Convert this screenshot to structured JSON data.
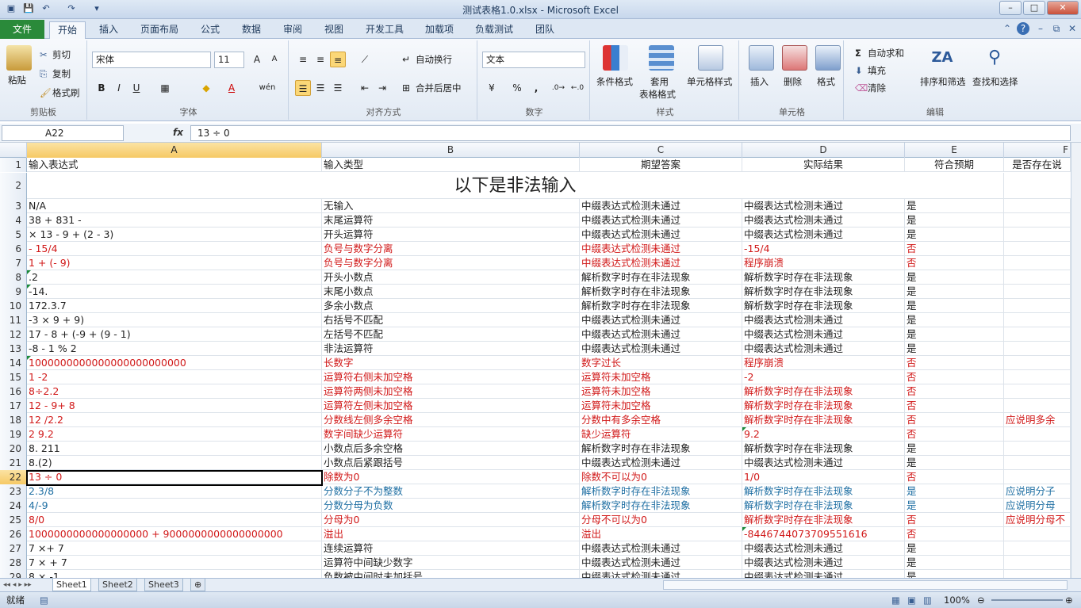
{
  "window": {
    "title": "测试表格1.0.xlsx  -  Microsoft Excel"
  },
  "tabs": [
    "文件",
    "开始",
    "插入",
    "页面布局",
    "公式",
    "数据",
    "审阅",
    "视图",
    "开发工具",
    "加载项",
    "负载测试",
    "团队"
  ],
  "ribbon": {
    "clipboard": {
      "label": "剪贴板",
      "paste": "粘贴",
      "cut": "剪切",
      "copy": "复制",
      "painter": "格式刷"
    },
    "font": {
      "label": "字体",
      "name": "宋体",
      "size": "11",
      "bold": "B",
      "italic": "I",
      "underline": "U",
      "phonetic": "wén"
    },
    "alignment": {
      "label": "对齐方式",
      "wrap": "自动换行",
      "merge": "合并后居中"
    },
    "number": {
      "label": "数字",
      "format": "文本",
      "percent": "%",
      "comma": ","
    },
    "styles": {
      "label": "样式",
      "conditional": "条件格式",
      "table_line1": "套用",
      "table_line2": "表格格式",
      "cell_styles": "单元格样式"
    },
    "cells": {
      "label": "单元格",
      "insert": "插入",
      "delete": "删除",
      "format": "格式"
    },
    "editing": {
      "label": "编辑",
      "autosum": "自动求和",
      "fill": "填充",
      "clear": "清除",
      "sort": "排序和筛选",
      "find": "查找和选择"
    }
  },
  "formula_bar": {
    "name_box": "A22",
    "fx": "fx",
    "formula": "13 ÷ 0"
  },
  "columns": [
    "A",
    "B",
    "C",
    "D",
    "E",
    "F"
  ],
  "sheet": {
    "header": [
      "输入表达式",
      "输入类型",
      "期望答案",
      "实际结果",
      "符合预期",
      "是否存在说"
    ],
    "banner": "以下是非法输入",
    "rows": [
      {
        "n": "3",
        "c": "",
        "a": "N/A",
        "b": "无输入",
        "cc": "中缀表达式检测未通过",
        "d": "中缀表达式检测未通过",
        "e": "是",
        "f": ""
      },
      {
        "n": "4",
        "c": "",
        "a": "38 + 831 -",
        "b": "末尾运算符",
        "cc": "中缀表达式检测未通过",
        "d": "中缀表达式检测未通过",
        "e": "是",
        "f": ""
      },
      {
        "n": "5",
        "c": "",
        "a": "× 13 - 9 + (2 - 3)",
        "b": "开头运算符",
        "cc": "中缀表达式检测未通过",
        "d": "中缀表达式检测未通过",
        "e": "是",
        "f": ""
      },
      {
        "n": "6",
        "c": "red",
        "a": "- 15/4",
        "b": "负号与数字分离",
        "cc": "中缀表达式检测未通过",
        "d": "-15/4",
        "e": "否",
        "f": ""
      },
      {
        "n": "7",
        "c": "red",
        "a": "1 + (- 9)",
        "b": "负号与数字分离",
        "cc": "中缀表达式检测未通过",
        "d": "程序崩溃",
        "e": "否",
        "f": ""
      },
      {
        "n": "8",
        "c": "",
        "a": ".2",
        "b": "开头小数点",
        "cc": "解析数字时存在非法现象",
        "d": "解析数字时存在非法现象",
        "e": "是",
        "f": "",
        "tri": "a"
      },
      {
        "n": "9",
        "c": "",
        "a": "-14.",
        "b": "末尾小数点",
        "cc": "解析数字时存在非法现象",
        "d": "解析数字时存在非法现象",
        "e": "是",
        "f": "",
        "tri": "a"
      },
      {
        "n": "10",
        "c": "",
        "a": "172.3.7",
        "b": "多余小数点",
        "cc": "解析数字时存在非法现象",
        "d": "解析数字时存在非法现象",
        "e": "是",
        "f": ""
      },
      {
        "n": "11",
        "c": "",
        "a": "-3 × 9 + 9)",
        "b": "右括号不匹配",
        "cc": "中缀表达式检测未通过",
        "d": "中缀表达式检测未通过",
        "e": "是",
        "f": ""
      },
      {
        "n": "12",
        "c": "",
        "a": "17 - 8 + (-9 + (9 - 1)",
        "b": "左括号不匹配",
        "cc": "中缀表达式检测未通过",
        "d": "中缀表达式检测未通过",
        "e": "是",
        "f": ""
      },
      {
        "n": "13",
        "c": "",
        "a": "-8 - 1 % 2",
        "b": "非法运算符",
        "cc": "中缀表达式检测未通过",
        "d": "中缀表达式检测未通过",
        "e": "是",
        "f": ""
      },
      {
        "n": "14",
        "c": "red",
        "a": "1000000000000000000000000",
        "b": "长数字",
        "cc": "数字过长",
        "d": "程序崩溃",
        "e": "否",
        "f": "",
        "tri": "a"
      },
      {
        "n": "15",
        "c": "red",
        "a": "1 -2",
        "b": "运算符右侧未加空格",
        "cc": "运算符未加空格",
        "d": "-2",
        "e": "否",
        "f": ""
      },
      {
        "n": "16",
        "c": "red",
        "a": "8÷2.2",
        "b": "运算符两侧未加空格",
        "cc": "运算符未加空格",
        "d": "解析数字时存在非法现象",
        "e": "否",
        "f": ""
      },
      {
        "n": "17",
        "c": "red",
        "a": "12 - 9+ 8",
        "b": "运算符左侧未加空格",
        "cc": "运算符未加空格",
        "d": "解析数字时存在非法现象",
        "e": "否",
        "f": ""
      },
      {
        "n": "18",
        "c": "red",
        "a": "12 /2.2",
        "b": "分数线左侧多余空格",
        "cc": "分数中有多余空格",
        "d": "解析数字时存在非法现象",
        "e": "否",
        "f": "应说明多余"
      },
      {
        "n": "19",
        "c": "red",
        "a": "2 9.2",
        "b": "数字间缺少运算符",
        "cc": "缺少运算符",
        "d": "9.2",
        "e": "否",
        "f": "",
        "tri": "d"
      },
      {
        "n": "20",
        "c": "",
        "a": "8. 211",
        "b": "小数点后多余空格",
        "cc": "解析数字时存在非法现象",
        "d": "解析数字时存在非法现象",
        "e": "是",
        "f": ""
      },
      {
        "n": "21",
        "c": "",
        "a": "8.(2)",
        "b": "小数点后紧跟括号",
        "cc": "中缀表达式检测未通过",
        "d": "中缀表达式检测未通过",
        "e": "是",
        "f": ""
      },
      {
        "n": "22",
        "c": "red",
        "a": "13 ÷ 0",
        "b": "除数为0",
        "cc": "除数不可以为0",
        "d": "1/0",
        "e": "否",
        "f": "",
        "sel": true
      },
      {
        "n": "23",
        "c": "blue",
        "a": "2.3/8",
        "b": "分数分子不为整数",
        "cc": "解析数字时存在非法现象",
        "d": "解析数字时存在非法现象",
        "e": "是",
        "f": "应说明分子"
      },
      {
        "n": "24",
        "c": "blue",
        "a": "4/-9",
        "b": "分数分母为负数",
        "cc": "解析数字时存在非法现象",
        "d": "解析数字时存在非法现象",
        "e": "是",
        "f": "应说明分母"
      },
      {
        "n": "25",
        "c": "red",
        "a": "8/0",
        "b": "分母为0",
        "cc": "分母不可以为0",
        "d": "解析数字时存在非法现象",
        "e": "否",
        "f": "应说明分母不"
      },
      {
        "n": "26",
        "c": "red",
        "a": "1000000000000000000 + 9000000000000000000",
        "b": "溢出",
        "cc": "溢出",
        "d": "-8446744073709551616",
        "e": "否",
        "f": "",
        "tri": "d"
      },
      {
        "n": "27",
        "c": "",
        "a": "7 ×+ 7",
        "b": "连续运算符",
        "cc": "中缀表达式检测未通过",
        "d": "中缀表达式检测未通过",
        "e": "是",
        "f": ""
      },
      {
        "n": "28",
        "c": "",
        "a": "7 × + 7",
        "b": "运算符中间缺少数字",
        "cc": "中缀表达式检测未通过",
        "d": "中缀表达式检测未通过",
        "e": "是",
        "f": ""
      },
      {
        "n": "29",
        "c": "",
        "a": "8 × -1",
        "b": "负数被中间时未加括号",
        "cc": "中缀表达式检测未通过",
        "d": "中缀表达式检测未通过",
        "e": "是",
        "f": ""
      }
    ]
  },
  "sheet_tabs": [
    "Sheet1",
    "Sheet2",
    "Sheet3"
  ],
  "status": {
    "ready": "就绪",
    "zoom": "100%"
  },
  "colors": {
    "ribbon_file": "#2a8a3a",
    "error_red": "#d11919",
    "note_blue": "#1f6fa3",
    "selection": "#f6c965"
  }
}
